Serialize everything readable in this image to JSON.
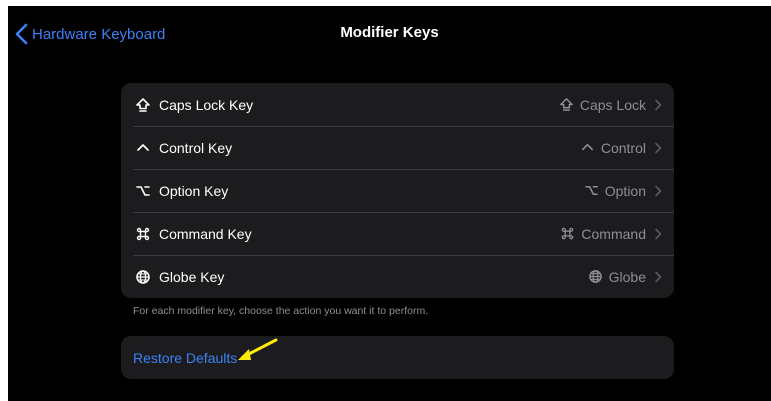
{
  "nav": {
    "back_label": "Hardware Keyboard",
    "title": "Modifier Keys"
  },
  "keys": [
    {
      "label": "Caps Lock Key",
      "value": "Caps Lock",
      "icon": "caps-lock-icon"
    },
    {
      "label": "Control Key",
      "value": "Control",
      "icon": "control-icon"
    },
    {
      "label": "Option Key",
      "value": "Option",
      "icon": "option-icon"
    },
    {
      "label": "Command Key",
      "value": "Command",
      "icon": "command-icon"
    },
    {
      "label": "Globe Key",
      "value": "Globe",
      "icon": "globe-icon"
    }
  ],
  "footnote": "For each modifier key, choose the action you want it to perform.",
  "restore_label": "Restore Defaults",
  "colors": {
    "background": "#000000",
    "cell": "#1c1c1e",
    "separator": "#3a3a3c",
    "accent": "#3a82f6",
    "secondary_text": "#8e8e93",
    "annotation": "#ffee00"
  }
}
